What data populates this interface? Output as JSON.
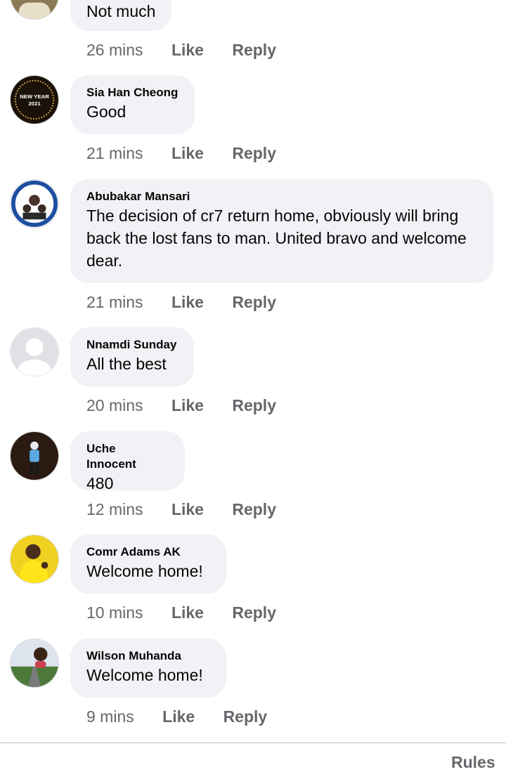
{
  "comments": [
    {
      "author": "",
      "text": "Not much",
      "time": "26 mins"
    },
    {
      "author": "Sia Han Cheong",
      "text": "Good",
      "time": "21 mins",
      "avatar_badge": "NEW YEAR 2021"
    },
    {
      "author": "Abubakar Mansari",
      "text": "The decision of cr7 return home, obviously will bring back the lost fans to man. United bravo and welcome dear.",
      "time": "21 mins"
    },
    {
      "author": "Nnamdi Sunday",
      "text": "All the best",
      "time": "20 mins"
    },
    {
      "author": "Uche Innocent",
      "text": "480",
      "time": "12 mins"
    },
    {
      "author": "Comr Adams AK",
      "text": "Welcome home!",
      "time": "10 mins"
    },
    {
      "author": "Wilson Muhanda",
      "text": "Welcome home!",
      "time": "9 mins"
    }
  ],
  "actions": {
    "like": "Like",
    "reply": "Reply"
  },
  "footer": {
    "rules": "Rules"
  },
  "colors": {
    "bubble": "#f0f2f5",
    "meta_text": "#65676b",
    "name_text": "#050505"
  }
}
